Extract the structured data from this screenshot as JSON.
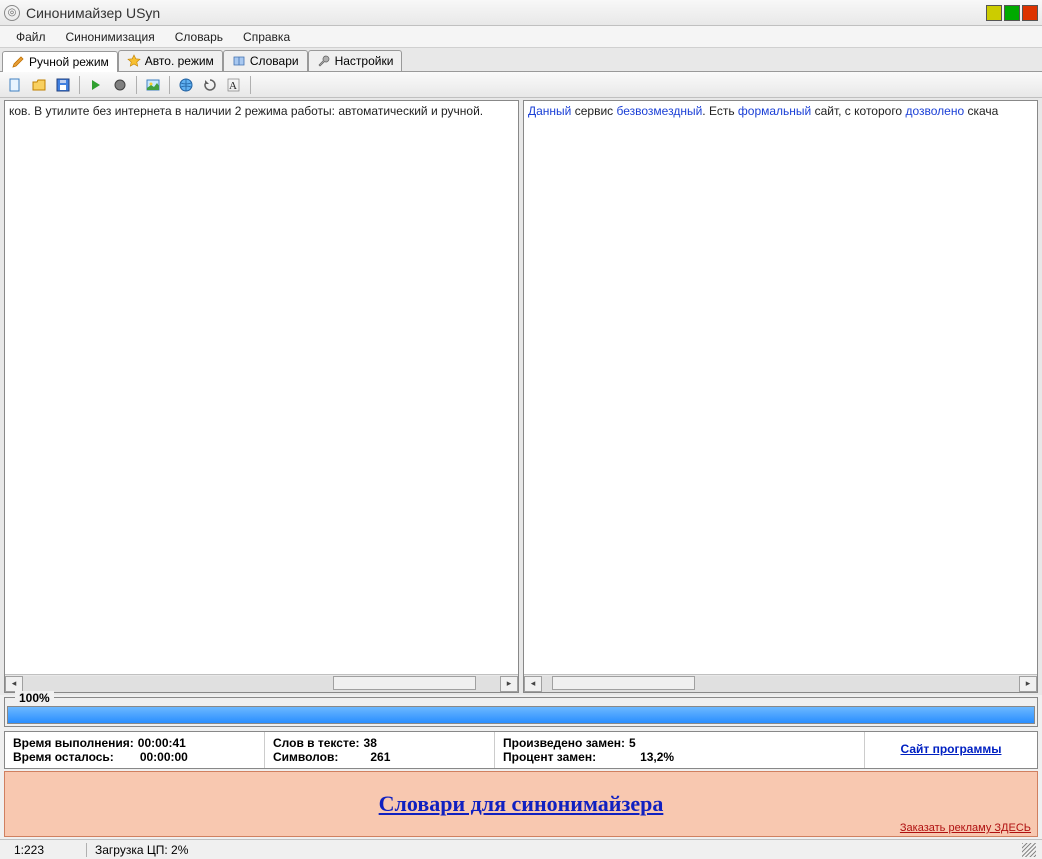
{
  "window": {
    "title": "Синонимайзер USyn"
  },
  "menu": {
    "file": "Файл",
    "synonymize": "Синонимизация",
    "dictionary": "Словарь",
    "help": "Справка"
  },
  "tabs": {
    "manual": "Ручной режим",
    "auto": "Авто. режим",
    "dicts": "Словари",
    "settings": "Настройки"
  },
  "toolbar": {
    "new": "new-file-icon",
    "open": "open-folder-icon",
    "save": "save-disk-icon",
    "run": "run-arrow-icon",
    "stop": "stop-icon",
    "img": "picture-icon",
    "globe": "globe-icon",
    "refresh": "refresh-icon",
    "font": "font-icon"
  },
  "left_text": "ков. В утилите без интернета в наличии 2 режима работы: автоматический и ручной.",
  "right_text": {
    "parts": [
      {
        "t": "Данный",
        "syn": true
      },
      {
        "t": " сервис ",
        "syn": false
      },
      {
        "t": "безвозмездный",
        "syn": true
      },
      {
        "t": ". Есть ",
        "syn": false
      },
      {
        "t": "формальный",
        "syn": true
      },
      {
        "t": " сайт, с которого ",
        "syn": false
      },
      {
        "t": "дозволено",
        "syn": true
      },
      {
        "t": " скача",
        "syn": false
      }
    ]
  },
  "progress": {
    "label": "100%",
    "percent": 100
  },
  "stats": {
    "time_exec_label": "Время выполнения:",
    "time_exec_value": "00:00:41",
    "time_left_label": "Время осталось:",
    "time_left_value": "00:00:00",
    "words_label": "Слов в тексте:",
    "words_value": "38",
    "chars_label": "Символов:",
    "chars_value": "261",
    "replaced_label": "Произведено замен:",
    "replaced_value": "5",
    "pct_label": "Процент замен:",
    "pct_value": "13,2%",
    "site_link": "Сайт программы"
  },
  "ad": {
    "main": "Словари для синонимайзера",
    "small": "Заказать рекламу ЗДЕСЬ"
  },
  "status": {
    "pos": "1:223",
    "cpu": "Загрузка ЦП: 2%"
  }
}
